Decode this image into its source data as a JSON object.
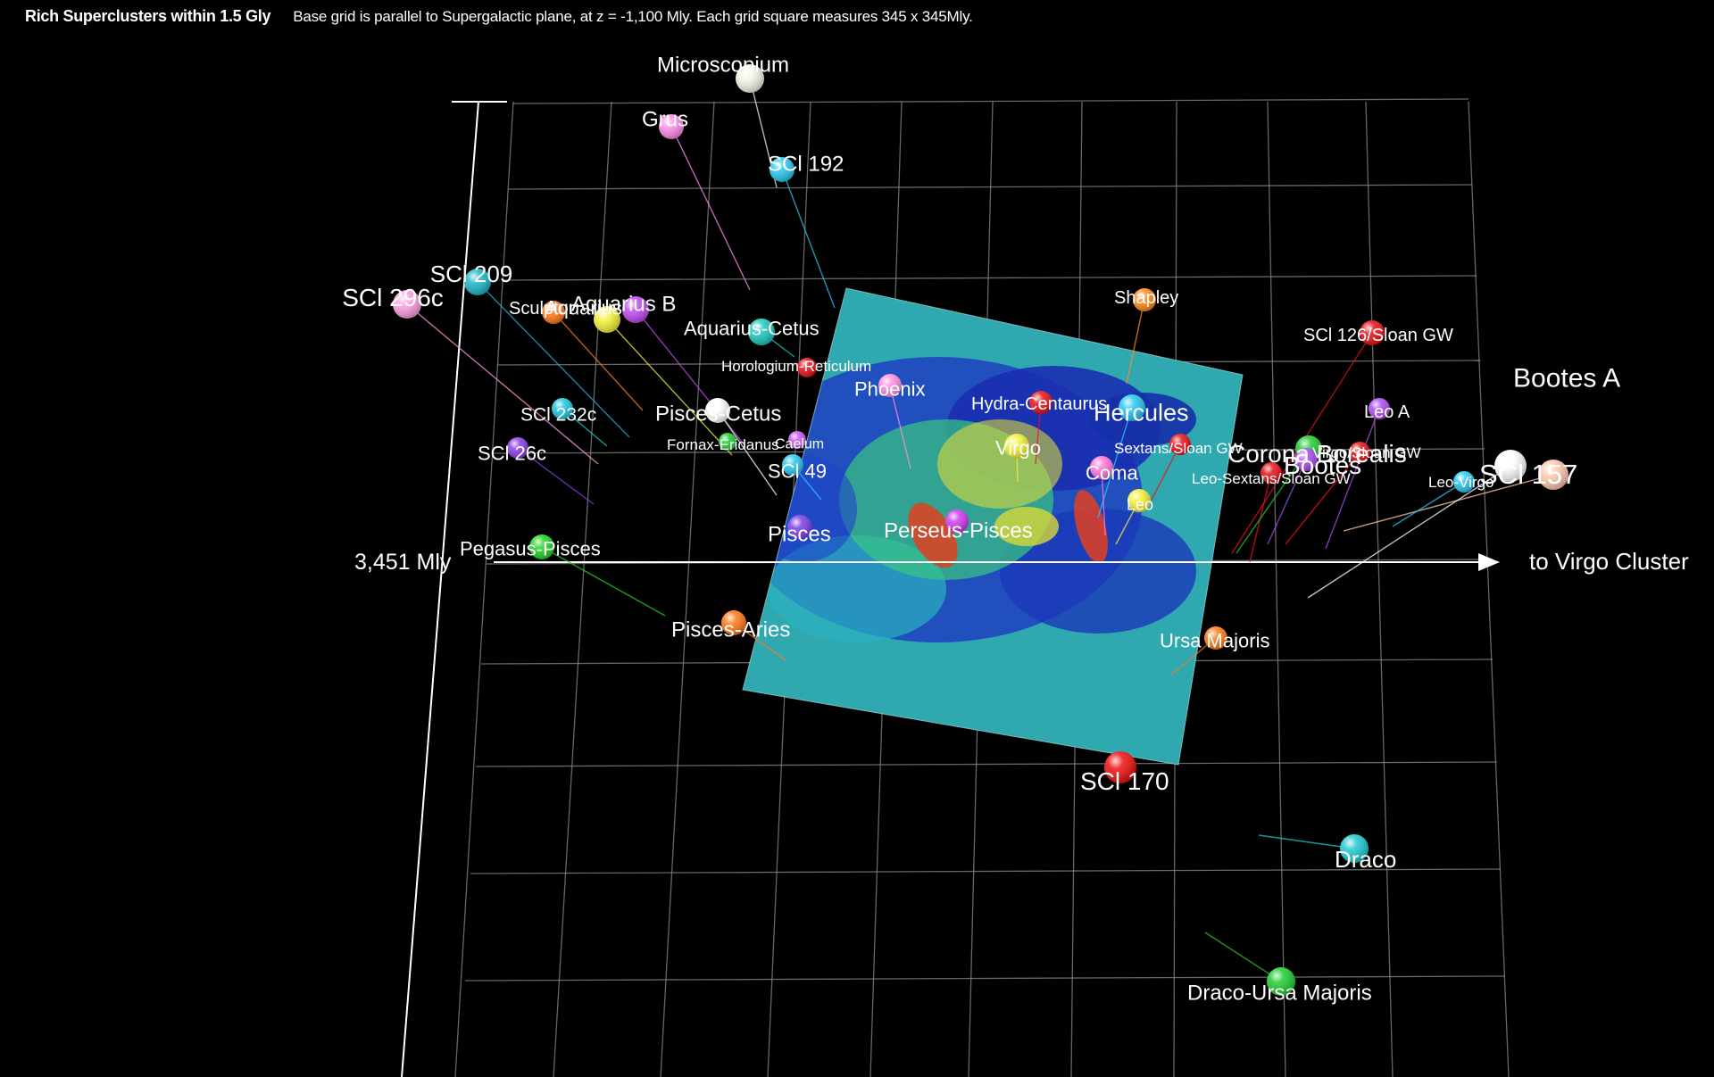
{
  "header": {
    "title": "Rich Superclusters within 1.5 Gly",
    "caption": "Base grid is parallel to Supergalactic plane, at z = -1,100 Mly. Each grid square measures 345 x 345Mly."
  },
  "scale_label": "3,451 Mly",
  "axis_label": "to Virgo Cluster",
  "colors": {
    "background": "#000000",
    "grid": "#8a8a8a",
    "axis": "#ffffff",
    "map_low": "#1c2fb5",
    "map_mid": "#2fb8b0",
    "map_high": "#d43a1a"
  },
  "superclusters": [
    {
      "name": "Microscopium",
      "color": "#f4f4e8"
    },
    {
      "name": "Grus",
      "color": "#ff8be8"
    },
    {
      "name": "SCl 192",
      "color": "#29c8f0"
    },
    {
      "name": "SCl 209",
      "color": "#1fb5c9"
    },
    {
      "name": "SCl 296c",
      "color": "#ff9ee0"
    },
    {
      "name": "Sculptor",
      "color": "#ff7a1a"
    },
    {
      "name": "Aquarius",
      "color": "#f2f23a"
    },
    {
      "name": "Aquarius B",
      "color": "#c04cf0"
    },
    {
      "name": "Aquarius-Cetus",
      "color": "#1cc9c0"
    },
    {
      "name": "Horologium-Reticulum",
      "color": "#e8121a"
    },
    {
      "name": "Phoenix",
      "color": "#ff8fe0"
    },
    {
      "name": "Pisces-Cetus",
      "color": "#ffffff"
    },
    {
      "name": "SCl 232c",
      "color": "#20c8e0"
    },
    {
      "name": "SCl 26c",
      "color": "#8a3ee6"
    },
    {
      "name": "Fornax-Eridanus",
      "color": "#22cc33"
    },
    {
      "name": "Caelum",
      "color": "#c85cf0"
    },
    {
      "name": "SCl 49",
      "color": "#29c8f0"
    },
    {
      "name": "Pegasus-Pisces",
      "color": "#22d622"
    },
    {
      "name": "Pisces",
      "color": "#7a3ee6"
    },
    {
      "name": "Perseus-Pisces",
      "color": "#d23cf0"
    },
    {
      "name": "Pisces-Aries",
      "color": "#ff7a1a"
    },
    {
      "name": "Shapley",
      "color": "#ff8a1a"
    },
    {
      "name": "Hydra-Centaurus",
      "color": "#e8121a"
    },
    {
      "name": "Hercules",
      "color": "#29c8f0"
    },
    {
      "name": "Virgo",
      "color": "#f2f23a"
    },
    {
      "name": "Coma",
      "color": "#ff7ad8"
    },
    {
      "name": "Leo",
      "color": "#f2f23a"
    },
    {
      "name": "Sextans/Sloan GW",
      "color": "#e8121a"
    },
    {
      "name": "Leo-Sextans/Sloan GW",
      "color": "#e8121a"
    },
    {
      "name": "Corona Borealis",
      "color": "#22cc33"
    },
    {
      "name": "Bootes",
      "color": "#a84cf0"
    },
    {
      "name": "Virgo/Sloan GW",
      "color": "#e8121a"
    },
    {
      "name": "SCl 126/Sloan GW",
      "color": "#e8121a"
    },
    {
      "name": "Leo A",
      "color": "#b04cf0"
    },
    {
      "name": "Bootes A",
      "color": "#ffc9b0"
    },
    {
      "name": "SCl 157",
      "color": "#ffffff"
    },
    {
      "name": "Leo-Virgo",
      "color": "#29c8f0"
    },
    {
      "name": "Ursa Majoris",
      "color": "#ff7a1a"
    },
    {
      "name": "SCl 170",
      "color": "#ee1010"
    },
    {
      "name": "Draco",
      "color": "#1fc9d0"
    },
    {
      "name": "Draco-Ursa Majoris",
      "color": "#22cc33"
    }
  ]
}
